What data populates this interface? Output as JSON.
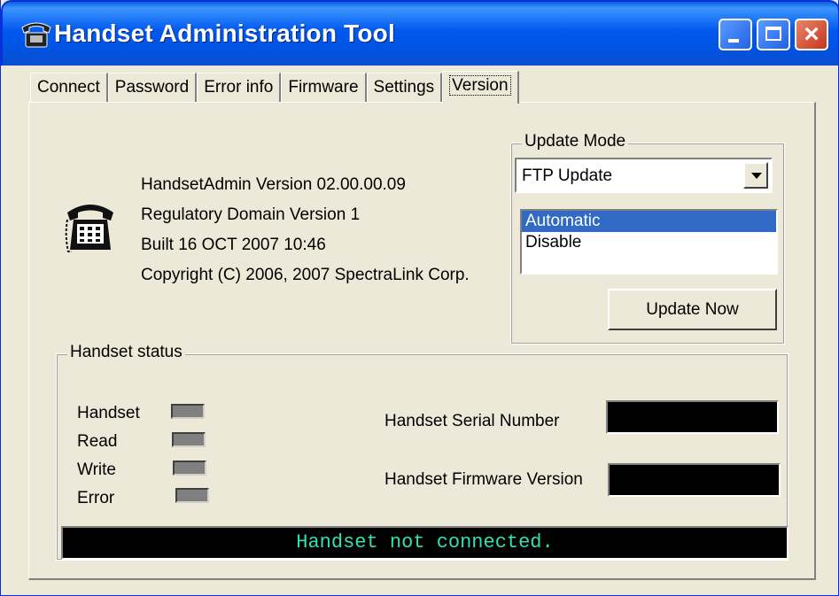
{
  "window": {
    "title": "Handset Administration Tool",
    "icon": "phone-icon",
    "controls": {
      "minimize": "minimize-icon",
      "maximize": "maximize-icon",
      "close": "×"
    }
  },
  "tabs": [
    {
      "label": "Connect"
    },
    {
      "label": "Password"
    },
    {
      "label": "Error info"
    },
    {
      "label": "Firmware"
    },
    {
      "label": "Settings"
    },
    {
      "label": "Version",
      "active": true
    }
  ],
  "version_info": {
    "icon": "phone-icon",
    "line1": "HandsetAdmin Version 02.00.00.09",
    "line2": "Regulatory Domain Version 1",
    "line3": "Built 16 OCT 2007   10:46",
    "line4": "Copyright (C) 2006, 2007 SpectraLink Corp."
  },
  "update_mode": {
    "label": "Update Mode",
    "selected": "FTP Update",
    "list": [
      {
        "label": "Automatic",
        "selected": true
      },
      {
        "label": "Disable",
        "selected": false
      }
    ],
    "button": "Update Now"
  },
  "handset_status": {
    "label": "Handset status",
    "indicators": [
      {
        "label": "Handset"
      },
      {
        "label": "Read"
      },
      {
        "label": "Write"
      },
      {
        "label": "Error"
      }
    ],
    "serial_label": "Handset Serial Number",
    "serial_value": "",
    "firmware_label": "Handset Firmware Version",
    "firmware_value": "",
    "message": "Handset not connected."
  },
  "colors": {
    "title_blue": "#0054e3",
    "selection": "#316ac5",
    "status_text": "#33e0b0",
    "panel_bg": "#ece9d8"
  }
}
